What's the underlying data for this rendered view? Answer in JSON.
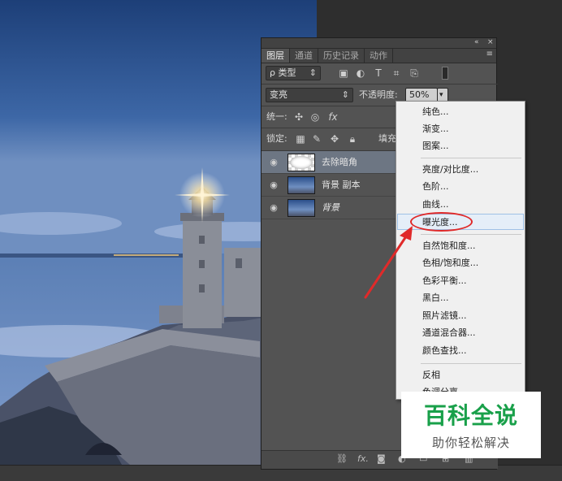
{
  "panel": {
    "controls": {
      "collapse": "«",
      "close": "×"
    },
    "tabs": [
      "图层",
      "通道",
      "历史记录",
      "动作"
    ],
    "tab_menu_icon": "≡",
    "filter_kind": "ρ 类型",
    "blend_mode": "变亮",
    "opacity_label": "不透明度:",
    "opacity_value": "50%",
    "unify_label": "统一:",
    "lock_label": "锁定:",
    "fill_label": "填充",
    "layers": [
      {
        "name": "去除暗角",
        "selected": true
      },
      {
        "name": "背景 副本",
        "selected": false
      },
      {
        "name": "背景",
        "selected": false
      }
    ],
    "bottom_icons": [
      "link-icon",
      "fx-icon",
      "mask-icon",
      "adjustment-icon",
      "group-icon",
      "new-layer-icon",
      "trash-icon"
    ]
  },
  "menu": {
    "items": [
      {
        "label": "纯色..."
      },
      {
        "label": "渐变..."
      },
      {
        "label": "图案..."
      },
      {
        "label": "亮度/对比度..."
      },
      {
        "label": "色阶..."
      },
      {
        "label": "曲线..."
      },
      {
        "label": "曝光度...",
        "hover": true
      },
      {
        "label": "自然饱和度..."
      },
      {
        "label": "色相/饱和度..."
      },
      {
        "label": "色彩平衡..."
      },
      {
        "label": "黑白..."
      },
      {
        "label": "照片滤镜..."
      },
      {
        "label": "通道混合器..."
      },
      {
        "label": "颜色查找..."
      },
      {
        "label": "反相"
      },
      {
        "label": "色调分离..."
      }
    ]
  },
  "watermark": {
    "title": "百科全说",
    "subtitle": "助你轻松解决"
  },
  "colors": {
    "panel_bg": "#535353",
    "selected_layer": "#6d7683",
    "annotation_red": "#e02a2a",
    "watermark_green": "#19a04a"
  }
}
